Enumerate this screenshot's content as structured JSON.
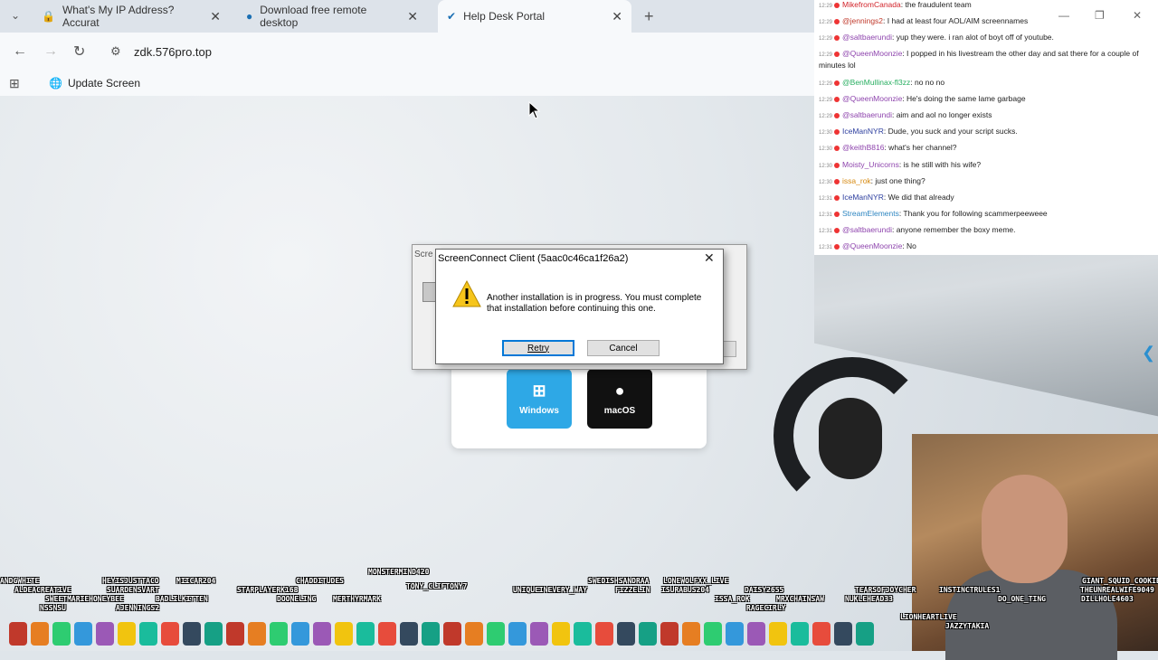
{
  "browser": {
    "tabs": [
      {
        "title": "What's My IP Address? Accurat",
        "active": false
      },
      {
        "title": "Download free remote desktop",
        "active": false
      },
      {
        "title": "Help Desk Portal",
        "active": true
      }
    ],
    "url": "zdk.576pro.top",
    "bookmark": "Update Screen"
  },
  "page": {
    "os_buttons": [
      {
        "label": "Windows",
        "color": "#2ea8e6"
      },
      {
        "label": "macOS",
        "color": "#111111"
      }
    ],
    "outer_dialog_title": "Scre"
  },
  "dialog": {
    "title": "ScreenConnect Client (5aac0c46ca1f26a2)",
    "message": "Another installation is in progress. You must complete that installation before continuing this one.",
    "retry": "Retry",
    "cancel": "Cancel"
  },
  "chat": [
    {
      "time": "12:29",
      "user": "MikefromCanada",
      "color": "#d2232a",
      "text": ": the fraudulent team"
    },
    {
      "time": "12:29",
      "user": "@jennings2",
      "color": "#c0392b",
      "text": ": I had at least four AOL/AIM screennames"
    },
    {
      "time": "12:29",
      "user": "@saltbaerundi",
      "color": "#8e44ad",
      "text": ": yup they were. i ran alot of boyt off of youtube."
    },
    {
      "time": "12:29",
      "user": "@QueenMoonzie",
      "color": "#8e44ad",
      "text": ": I popped in his livestream the other day and sat there for a couple of minutes lol"
    },
    {
      "time": "12:29",
      "user": "@BenMullinax-fl3zz",
      "color": "#27ae60",
      "text": ": no no no"
    },
    {
      "time": "12:29",
      "user": "@QueenMoonzie",
      "color": "#8e44ad",
      "text": ": He's doing the same lame garbage"
    },
    {
      "time": "12:29",
      "user": "@saltbaerundi",
      "color": "#8e44ad",
      "text": ": aim and aol no longer exists"
    },
    {
      "time": "12:30",
      "user": "IceManNYR",
      "color": "#2c3e9e",
      "text": ": Dude, you suck and your script sucks."
    },
    {
      "time": "12:30",
      "user": "@keithB816",
      "color": "#8e44ad",
      "text": ": what's her channel?"
    },
    {
      "time": "12:30",
      "user": "Moisty_Unicorns",
      "color": "#8e44ad",
      "text": ": is he still with his wife?"
    },
    {
      "time": "12:30",
      "user": "issa_rok",
      "color": "#d68910",
      "text": ": just one thing?"
    },
    {
      "time": "12:31",
      "user": "IceManNYR",
      "color": "#2c3e9e",
      "text": ": We did that already"
    },
    {
      "time": "12:31",
      "user": "StreamElements",
      "color": "#2e86c1",
      "text": ": Thank you for following scammerpeeweee"
    },
    {
      "time": "12:31",
      "user": "@saltbaerundi",
      "color": "#8e44ad",
      "text": ": anyone remember the boxy meme."
    },
    {
      "time": "12:31",
      "user": "@QueenMoonzie",
      "color": "#8e44ad",
      "text": ": No"
    }
  ],
  "overlay_names": [
    "ANDGWHITE",
    "ALDEACREATIVE",
    "SWEETMARIEHONEYBEE",
    "NSSNSU",
    "HEYISJUSTTACO",
    "SUARDENSVART",
    "BADLILKITTEN",
    "AJENNINGS2",
    "MIICAR204",
    "STARPLAYERK168",
    "CHADDITUDES",
    "DOONELING",
    "MONSTERMIND420",
    "MERTHYRMARK",
    "TONY_CLIFTONY7",
    "UNIQUEINEVERY_WAY",
    "SWEDISHSANDRAA",
    "LONEWOLFXX_LIVE",
    "FIZZELIN",
    "ISURABUS204",
    "DAISY2655",
    "ISSA_ROK",
    "MRXCHAINSAW",
    "TEARSOFJOYCHER",
    "INSTINCTRULES1",
    "NUKLEHEAD33",
    "GIANT_SQUID_COOKIE",
    "THEUNREALWIFE9049",
    "DO_ONE_TING",
    "DILLHOLE4603",
    "JAZZYTAKIA",
    "RAGECIRLY",
    "LIONHEARTLIVE"
  ]
}
